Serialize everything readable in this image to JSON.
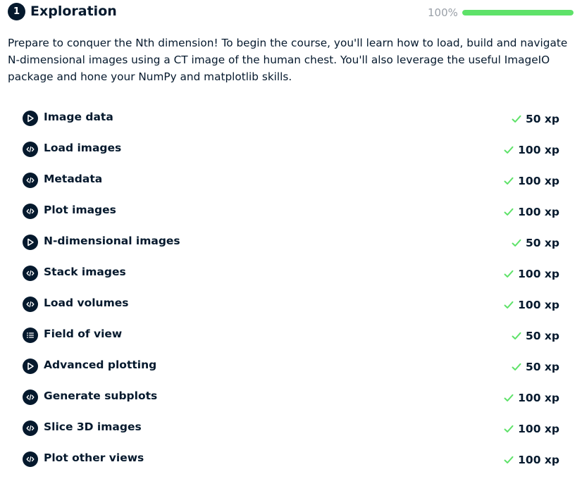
{
  "chapter": {
    "number": "1",
    "title": "Exploration",
    "progress_label": "100%",
    "progress_value": 1.0,
    "description": "Prepare to conquer the Nth dimension! To begin the course, you'll learn how to load, build and navigate N-dimensional images using a CT image of the human chest. You'll also leverage the useful ImageIO package and hone your NumPy and matplotlib skills."
  },
  "colors": {
    "accent_green": "#5ee269",
    "dark_navy": "#05192d",
    "check_green": "#5ee269"
  },
  "exercises": [
    {
      "title": "Image data",
      "xp": "50 xp",
      "icon": "video-play-icon"
    },
    {
      "title": "Load images",
      "xp": "100 xp",
      "icon": "code-icon"
    },
    {
      "title": "Metadata",
      "xp": "100 xp",
      "icon": "code-icon"
    },
    {
      "title": "Plot images",
      "xp": "100 xp",
      "icon": "code-icon"
    },
    {
      "title": "N-dimensional images",
      "xp": "50 xp",
      "icon": "video-play-icon"
    },
    {
      "title": "Stack images",
      "xp": "100 xp",
      "icon": "code-icon"
    },
    {
      "title": "Load volumes",
      "xp": "100 xp",
      "icon": "code-icon"
    },
    {
      "title": "Field of view",
      "xp": "50 xp",
      "icon": "list-icon"
    },
    {
      "title": "Advanced plotting",
      "xp": "50 xp",
      "icon": "video-play-icon"
    },
    {
      "title": "Generate subplots",
      "xp": "100 xp",
      "icon": "code-icon"
    },
    {
      "title": "Slice 3D images",
      "xp": "100 xp",
      "icon": "code-icon"
    },
    {
      "title": "Plot other views",
      "xp": "100 xp",
      "icon": "code-icon"
    }
  ]
}
